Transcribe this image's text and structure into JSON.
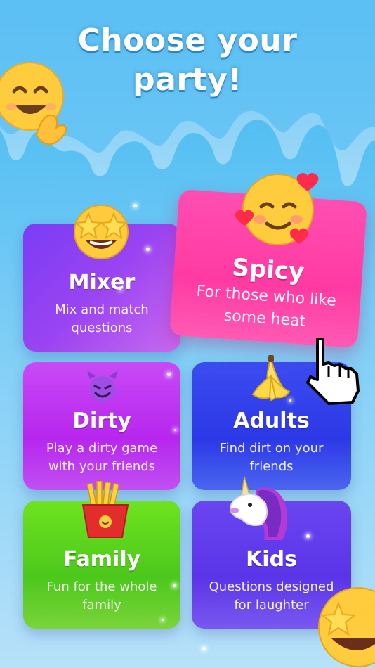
{
  "title_line1": "Choose your",
  "title_line2": "party!",
  "cards": {
    "mixer": {
      "name": "Mixer",
      "desc": "Mix and match questions"
    },
    "spicy": {
      "name": "Spicy",
      "desc": "For those who like some heat"
    },
    "dirty": {
      "name": "Dirty",
      "desc": "Play a dirty game with your friends"
    },
    "adults": {
      "name": "Adults",
      "desc": "Find dirt on your friends"
    },
    "family": {
      "name": "Family",
      "desc": "Fun for the whole family"
    },
    "kids": {
      "name": "Kids",
      "desc": "Questions designed for laughter"
    }
  },
  "icons": {
    "mixer": "star-struck-emoji-icon",
    "spicy": "smiling-face-with-hearts-emoji-icon",
    "dirty": "smiling-devil-emoji-icon",
    "adults": "banana-emoji-icon",
    "family": "french-fries-emoji-icon",
    "kids": "unicorn-emoji-icon",
    "pointer": "hand-pointer-cursor-icon"
  },
  "colors": {
    "background": "#62c4f4",
    "mixer": "#8a3ff4",
    "spicy": "#ff3aa2",
    "dirty": "#b726ee",
    "adults": "#2c38e6",
    "family": "#4cc81c",
    "kids": "#5a34e8"
  }
}
